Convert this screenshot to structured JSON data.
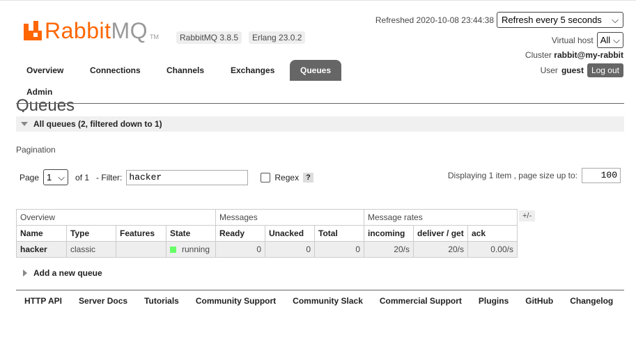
{
  "header": {
    "logo_rabbit": "Rabbit",
    "logo_mq": "MQ",
    "logo_tm": "TM",
    "version": "RabbitMQ 3.8.5",
    "erlang": "Erlang 23.0.2",
    "refreshed": "Refreshed 2020-10-08 23:44:38",
    "refresh_option": "Refresh every 5 seconds",
    "vhost_label": "Virtual host",
    "vhost_value": "All",
    "cluster_label": "Cluster",
    "cluster_value": "rabbit@my-rabbit",
    "user_label": "User",
    "user_value": "guest",
    "logout": "Log out"
  },
  "nav": {
    "overview": "Overview",
    "connections": "Connections",
    "channels": "Channels",
    "exchanges": "Exchanges",
    "queues": "Queues",
    "admin": "Admin"
  },
  "page_title": "Queues",
  "section": "All queues (2, filtered down to 1)",
  "pagination": {
    "label": "Pagination",
    "page_label": "Page",
    "page_value": "1",
    "of": "of 1",
    "filter_label": "- Filter:",
    "filter_value": "hacker",
    "regex_label": "Regex",
    "help": "?",
    "displaying": "Displaying 1 item , page size up to:",
    "page_size": "100"
  },
  "table": {
    "groups": [
      "Overview",
      "Messages",
      "Message rates"
    ],
    "columns": [
      "Name",
      "Type",
      "Features",
      "State",
      "Ready",
      "Unacked",
      "Total",
      "incoming",
      "deliver / get",
      "ack"
    ],
    "rows": [
      {
        "name": "hacker",
        "type": "classic",
        "features": "",
        "state": "running",
        "ready": "0",
        "unacked": "0",
        "total": "0",
        "incoming": "20/s",
        "deliver": "20/s",
        "ack": "0.00/s"
      }
    ],
    "plus_minus": "+/-"
  },
  "add_queue": "Add a new queue",
  "footer": [
    "HTTP API",
    "Server Docs",
    "Tutorials",
    "Community Support",
    "Community Slack",
    "Commercial Support",
    "Plugins",
    "GitHub",
    "Changelog"
  ],
  "colors": {
    "brand": "#ff6600",
    "nav_active": "#666666",
    "state_running": "#66ff66"
  }
}
